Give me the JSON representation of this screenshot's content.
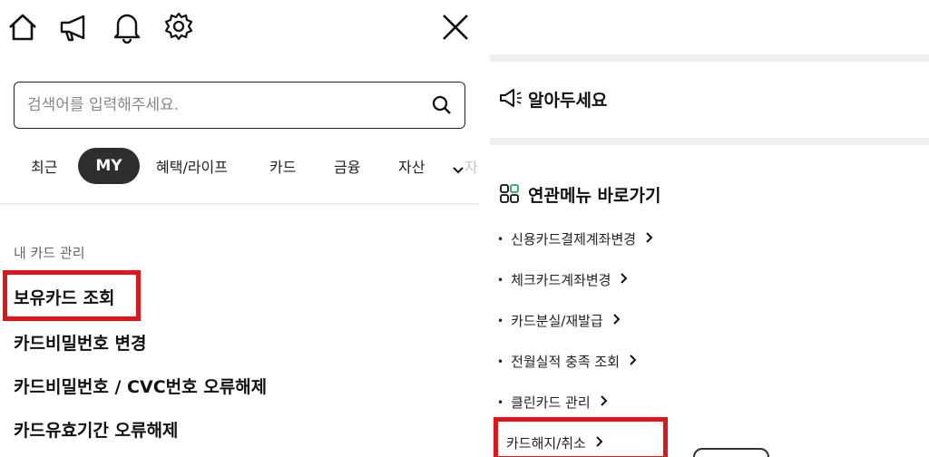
{
  "top_icons": [
    "home-icon",
    "megaphone-icon",
    "bell-icon",
    "gear-icon",
    "close-icon"
  ],
  "search": {
    "placeholder": "검색어를 입력해주세요."
  },
  "tabs": [
    {
      "label": "최근",
      "active": false
    },
    {
      "label": "MY",
      "active": true
    },
    {
      "label": "혜택/라이프",
      "active": false
    },
    {
      "label": "카드",
      "active": false
    },
    {
      "label": "금융",
      "active": false
    },
    {
      "label": "자산",
      "active": false
    },
    {
      "label": "자",
      "active": false
    }
  ],
  "card_section": {
    "label": "내 카드 관리",
    "items": [
      {
        "label": "보유카드 조회",
        "highlighted": true
      },
      {
        "label": "카드비밀번호 변경",
        "highlighted": false
      },
      {
        "label": "카드비밀번호 / CVC번호 오류해제",
        "highlighted": false
      },
      {
        "label": "카드유효기간 오류해제",
        "highlighted": false
      }
    ]
  },
  "notice": {
    "title": "알아두세요"
  },
  "related_menu": {
    "title": "연관메뉴 바로가기",
    "items": [
      {
        "label": "신용카드결제계좌변경",
        "highlighted": false
      },
      {
        "label": "체크카드계좌변경",
        "highlighted": false
      },
      {
        "label": "카드분실/재발급",
        "highlighted": false
      },
      {
        "label": "전월실적 충족 조회",
        "highlighted": false
      },
      {
        "label": "클린카드 관리",
        "highlighted": false
      },
      {
        "label": "카드해지/취소",
        "highlighted": true
      }
    ]
  },
  "colors": {
    "highlight": "#e0151b",
    "active_tab_bg": "#2e2e2e",
    "divider": "#ececec"
  }
}
